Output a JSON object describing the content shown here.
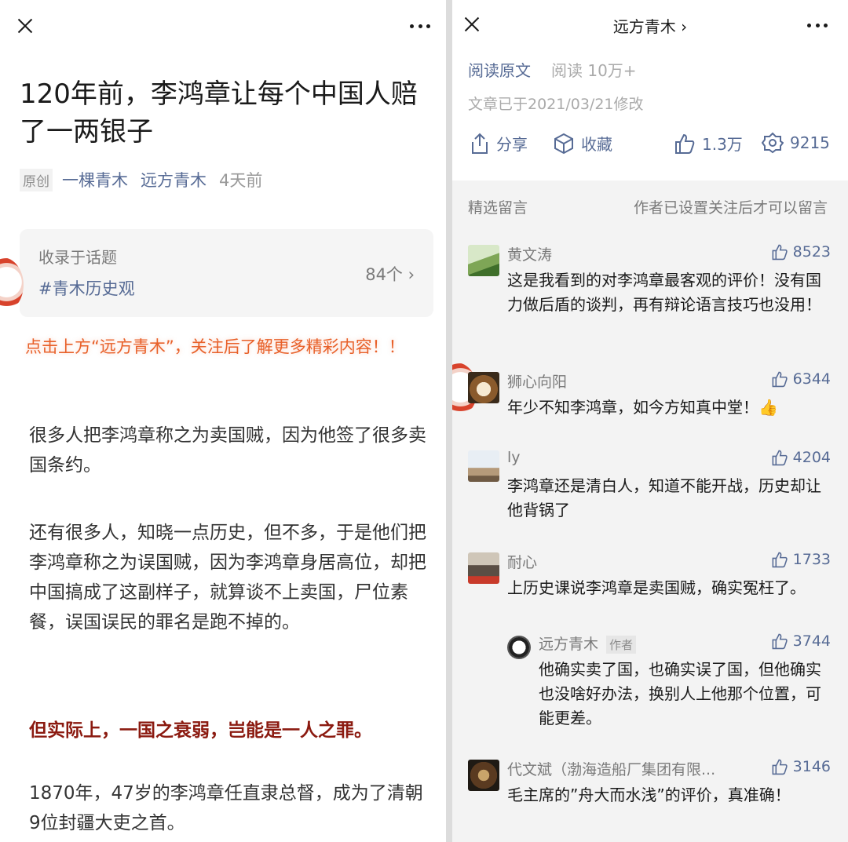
{
  "left": {
    "title": "120年前，李鸿章让每个中国人赔了一两银子",
    "meta": {
      "original": "原创",
      "author": "一棵青木",
      "account": "远方青木",
      "time": "4天前"
    },
    "topic": {
      "label": "收录于话题",
      "tag": "#青木历史观",
      "count": "84个 ›"
    },
    "cta": "点击上方“远方青木”，关注后了解更多精彩内容！！",
    "paragraphs": [
      "很多人把李鸿章称之为卖国贼，因为他签了很多卖国条约。",
      "还有很多人，知晓一点历史，但不多，于是他们把李鸿章称之为误国贼，因为李鸿章身居高位，却把中国搞成了这副样子，就算谈不上卖国，尸位素餐，误国误民的罪名是跑不掉的。",
      "但实际上，一国之衰弱，岂能是一人之罪。",
      "1870年，47岁的李鸿章任直隶总督，成为了清朝9位封疆大吏之首。"
    ]
  },
  "right": {
    "header_title": "远方青木 ›",
    "read_original": "阅读原文",
    "views": "阅读 10万+",
    "modified": "文章已于2021/03/21修改",
    "actions": {
      "share": "分享",
      "favorite": "收藏",
      "like_count": "1.3万",
      "wow_count": "9215"
    },
    "section": {
      "title": "精选留言",
      "note": "作者已设置关注后才可以留言"
    },
    "comments": [
      {
        "name": "黄文涛",
        "likes": "8523",
        "text": "这是我看到的对李鸿章最客观的评价！没有国力做后盾的谈判，再有辩论语言技巧也没用！"
      },
      {
        "name": "狮心向阳",
        "likes": "6344",
        "text": "年少不知李鸿章，如今方知真中堂！👍"
      },
      {
        "name": "ly",
        "likes": "4204",
        "text": "李鸿章还是清白人，知道不能开战，历史却让他背锅了"
      },
      {
        "name": "耐心",
        "likes": "1733",
        "text": "上历史课说李鸿章是卖国贼，确实冤枉了。"
      },
      {
        "name": "代文斌（渤海造船厂集团有限...",
        "likes": "3146",
        "text": "毛主席的”舟大而水浅”的评价，真准确！"
      }
    ],
    "reply": {
      "name": "远方青木",
      "badge": "作者",
      "likes": "3744",
      "text": "他确实卖了国，也确实误了国，但他确实也没啥好办法，换别人上他那个位置，可能更差。"
    }
  },
  "colors": {
    "link": "#576b95",
    "cta": "#e8612a",
    "emphasis": "#8b1a10"
  }
}
